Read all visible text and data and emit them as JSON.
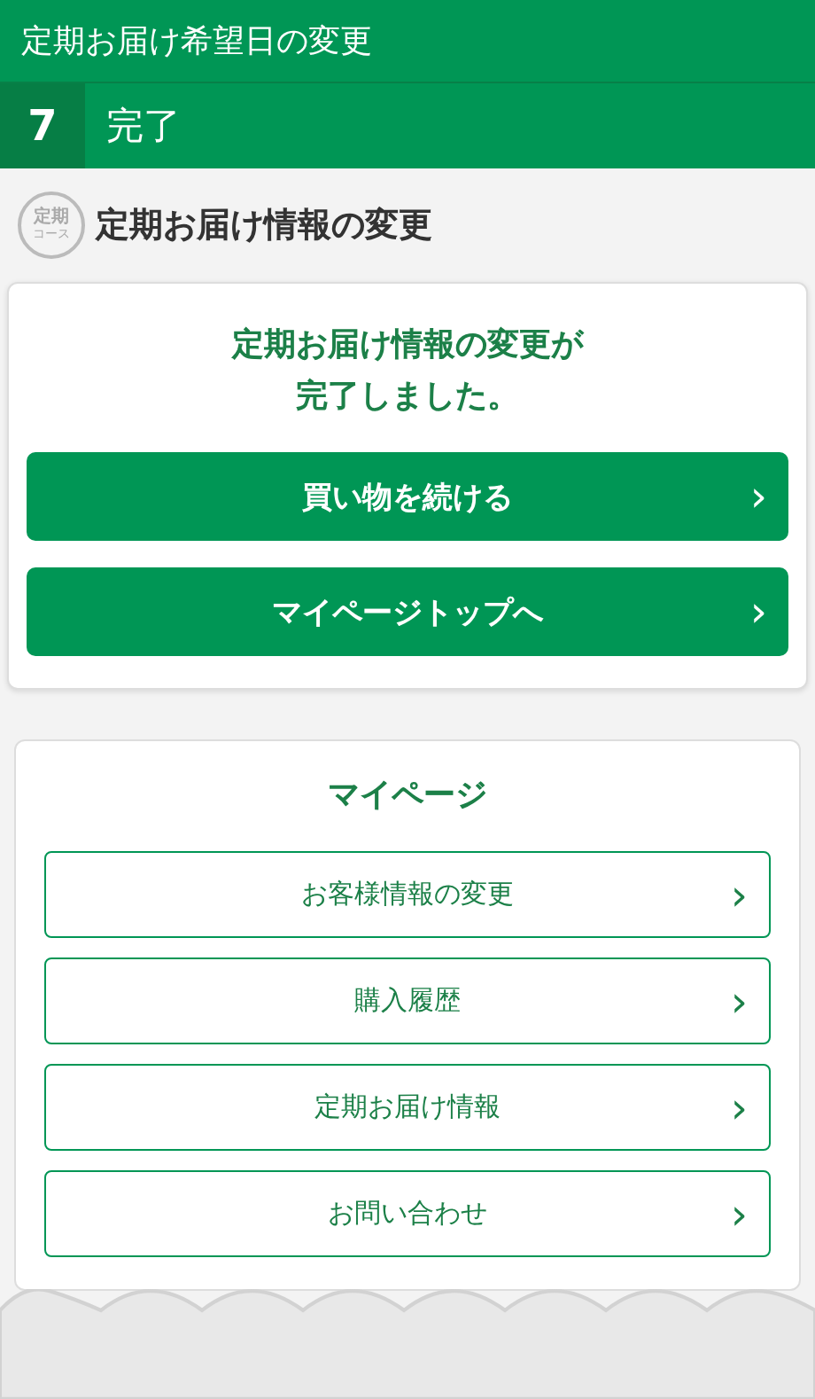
{
  "header": {
    "title": "定期お届け希望日の変更"
  },
  "step": {
    "number": "7",
    "label": "完了"
  },
  "section": {
    "badge": {
      "top": "定期",
      "bottom": "コース"
    },
    "title": "定期お届け情報の変更"
  },
  "completion": {
    "message_lines": [
      "定期お届け情報の変更が",
      "完了しました。"
    ],
    "buttons": [
      {
        "label": "買い物を続ける",
        "arrow": "›"
      },
      {
        "label": "マイページトップへ",
        "arrow": "›"
      }
    ]
  },
  "mypage": {
    "title": "マイページ",
    "links": [
      {
        "label": "お客様情報の変更",
        "arrow": "›"
      },
      {
        "label": "購入履歴",
        "arrow": "›"
      },
      {
        "label": "定期お届け情報",
        "arrow": "›"
      },
      {
        "label": "お問い合わせ",
        "arrow": "›"
      }
    ]
  }
}
